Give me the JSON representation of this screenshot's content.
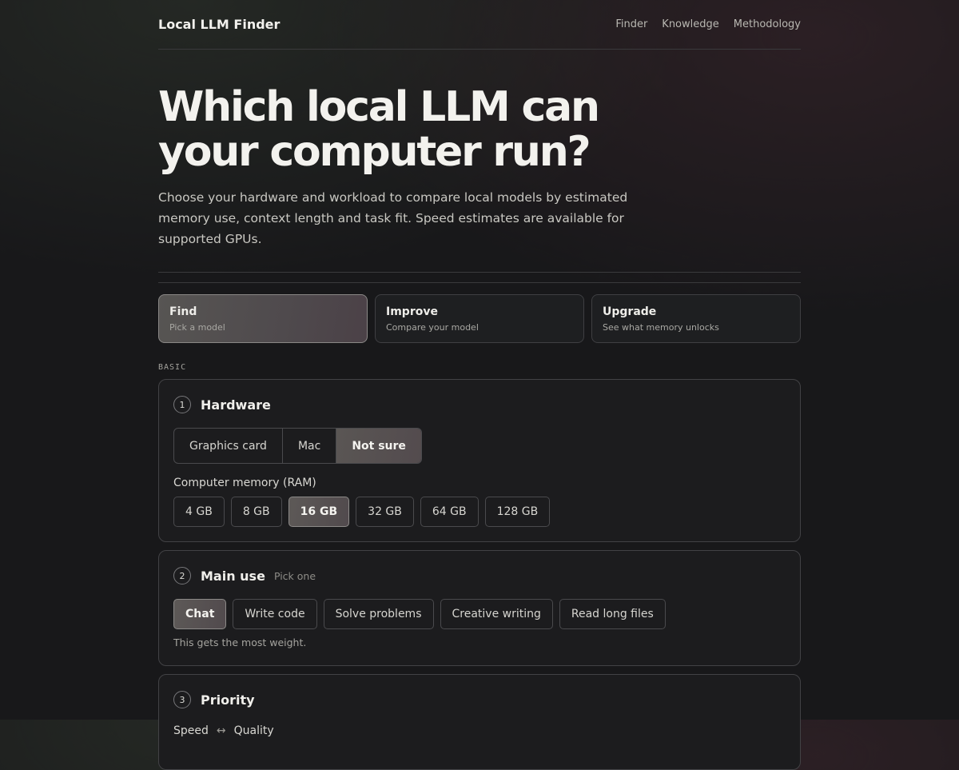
{
  "nav": {
    "brand": "Local LLM Finder",
    "links": [
      "Finder",
      "Knowledge",
      "Methodology"
    ]
  },
  "hero": {
    "title": "Which local LLM can your computer run?",
    "intro": "Choose your hardware and workload to compare local models by estimated memory use, context length and task fit. Speed estimates are available for supported GPUs."
  },
  "modes": [
    {
      "title": "Find",
      "subtitle": "Pick a model",
      "active": true
    },
    {
      "title": "Improve",
      "subtitle": "Compare your model",
      "active": false
    },
    {
      "title": "Upgrade",
      "subtitle": "See what memory unlocks",
      "active": false
    }
  ],
  "section_label": "BASIC",
  "hardware": {
    "number": "1",
    "title": "Hardware",
    "options": [
      "Graphics card",
      "Mac",
      "Not sure"
    ],
    "selected": "Not sure",
    "memory_label": "Computer memory (RAM)",
    "memory_options": [
      "4 GB",
      "8 GB",
      "16 GB",
      "32 GB",
      "64 GB",
      "128 GB"
    ],
    "memory_selected": "16 GB"
  },
  "main_use": {
    "number": "2",
    "title": "Main use",
    "subtitle": "Pick one",
    "options": [
      "Chat",
      "Write code",
      "Solve problems",
      "Creative writing",
      "Read long files"
    ],
    "selected": "Chat",
    "hint": "This gets the most weight."
  },
  "priority": {
    "number": "3",
    "title": "Priority",
    "left_label": "Speed",
    "arrow": "↔",
    "right_label": "Quality"
  }
}
